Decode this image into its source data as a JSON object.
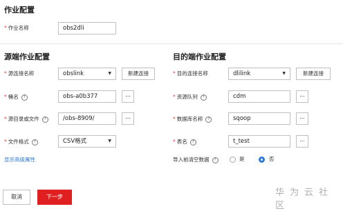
{
  "job": {
    "section_title": "作业配置",
    "name_label": "作业名称",
    "name_value": "obs2dli"
  },
  "source": {
    "section_title": "源端作业配置",
    "connection_label": "源连接名称",
    "connection_value": "obslink",
    "new_connection": "新建连接",
    "bucket_label": "桶名",
    "bucket_value": "obs-a0b377",
    "dir_label": "源目录或文件",
    "dir_value": "/obs-8909/",
    "format_label": "文件格式",
    "format_value": "CSV格式",
    "advanced_link": "显示高级属性",
    "browse": "..."
  },
  "destination": {
    "section_title": "目的端作业配置",
    "connection_label": "目的连接名称",
    "connection_value": "dlilink",
    "new_connection": "新建连接",
    "queue_label": "资源队列",
    "queue_value": "cdm",
    "database_label": "数据库名称",
    "database_value": "sqoop",
    "table_label": "表名",
    "table_value": "t_test",
    "clear_label": "导入前清空数据",
    "radio_yes": "是",
    "radio_no": "否",
    "selected": "否",
    "browse": "..."
  },
  "footer": {
    "cancel_label": "取消",
    "next_label": "下一步",
    "watermark": "华为云社区"
  },
  "required_marker": "*",
  "help_marker": "?",
  "caret": "▼",
  "colors": {
    "accent": "#2a7ad6",
    "primary_button": "#e02020",
    "required": "#e04040"
  }
}
